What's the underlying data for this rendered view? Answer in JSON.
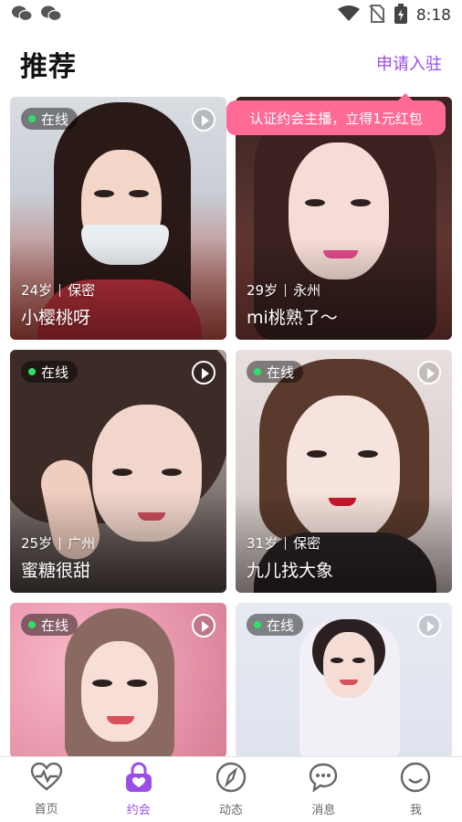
{
  "status_bar": {
    "time": "8:18",
    "left_icons": [
      "wechat-icon",
      "wechat-icon"
    ],
    "right_icons": [
      "wifi-icon",
      "no-sim-icon",
      "battery-charging-icon"
    ]
  },
  "header": {
    "title": "推荐",
    "apply_label": "申请入驻",
    "tooltip": "认证约会主播，立得1元红包"
  },
  "colors": {
    "accent": "#9b4de8",
    "tooltip_bg": "#ff6b95",
    "online_dot": "#2ee06a"
  },
  "cards": [
    {
      "status": "在线",
      "age": "24岁",
      "location": "保密",
      "name": "小樱桃呀"
    },
    {
      "status": "",
      "age": "29岁",
      "location": "永州",
      "name": "mi桃熟了～"
    },
    {
      "status": "在线",
      "age": "25岁",
      "location": "广州",
      "name": "蜜糖很甜"
    },
    {
      "status": "在线",
      "age": "31岁",
      "location": "保密",
      "name": "九儿找大象"
    },
    {
      "status": "在线",
      "age": "",
      "location": "",
      "name": ""
    },
    {
      "status": "在线",
      "age": "",
      "location": "",
      "name": ""
    }
  ],
  "tabbar": {
    "items": [
      {
        "label": "首页",
        "icon": "heartbeat-icon"
      },
      {
        "label": "约会",
        "icon": "lock-heart-icon",
        "active": true
      },
      {
        "label": "动态",
        "icon": "compass-icon"
      },
      {
        "label": "消息",
        "icon": "chat-bubble-icon"
      },
      {
        "label": "我",
        "icon": "smile-icon"
      }
    ]
  }
}
